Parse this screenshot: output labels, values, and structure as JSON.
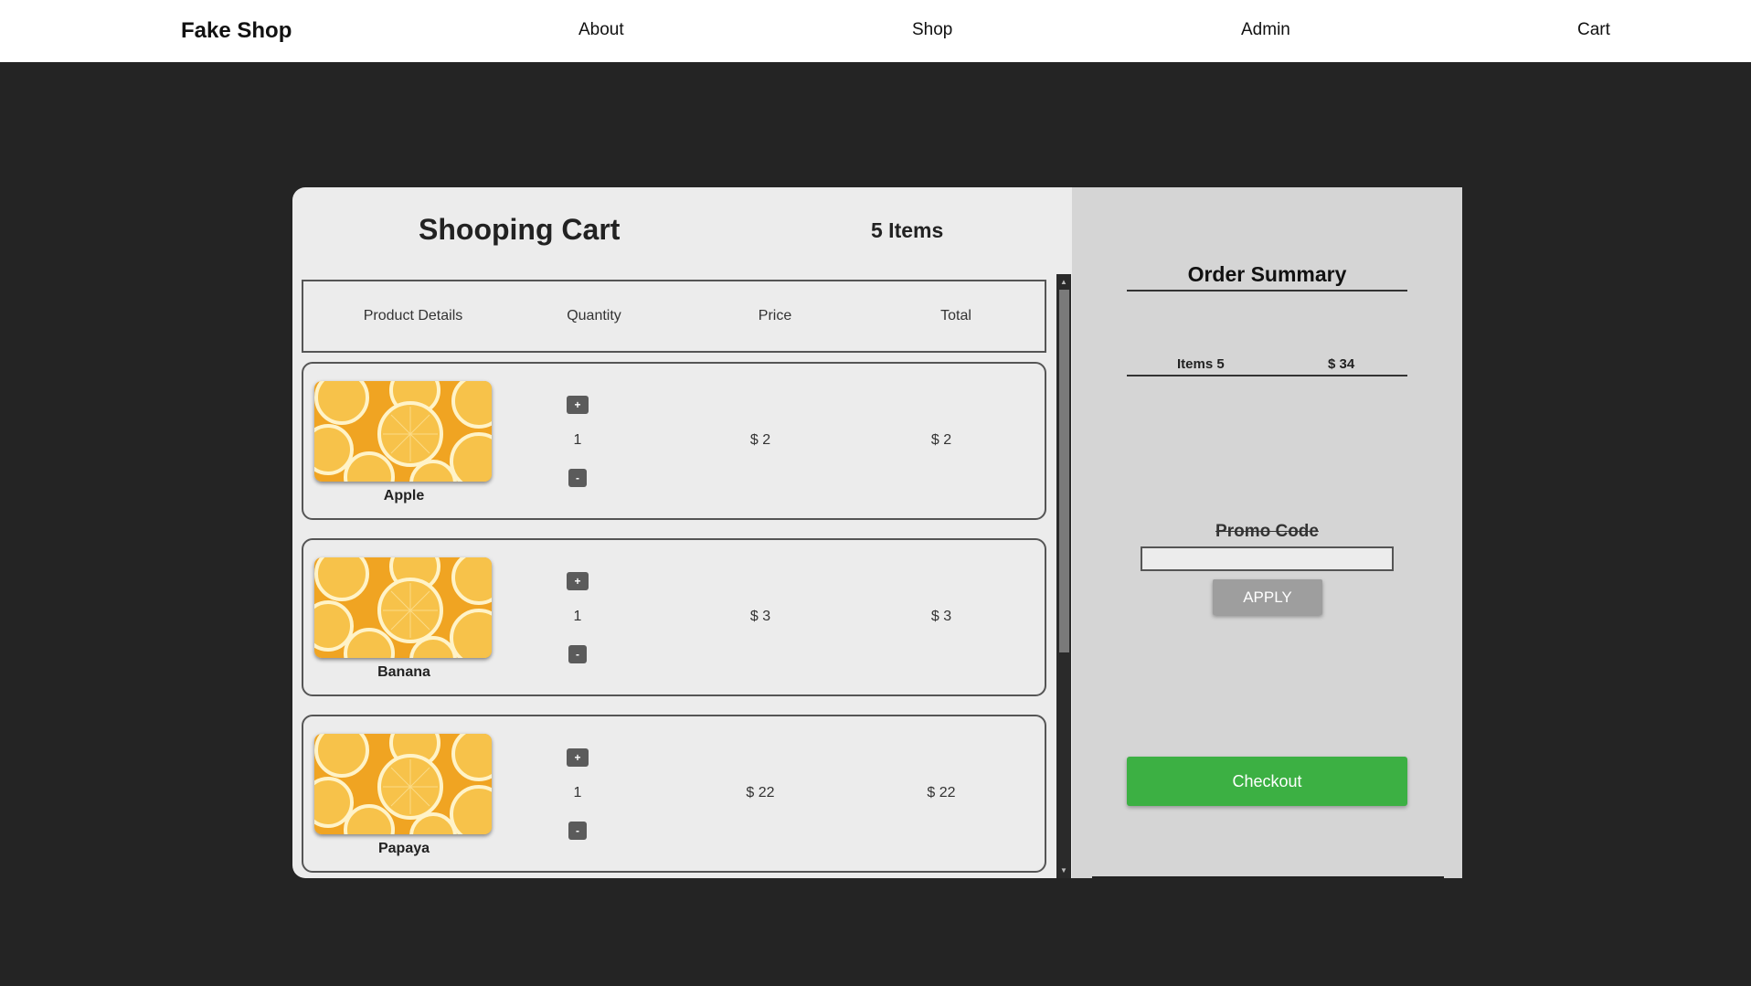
{
  "nav": {
    "brand": "Fake Shop",
    "links": [
      "About",
      "Shop",
      "Admin",
      "Cart"
    ]
  },
  "cart": {
    "title": "Shooping Cart",
    "item_count": "5 Items",
    "columns": [
      "Product Details",
      "Quantity",
      "Price",
      "Total"
    ],
    "items": [
      {
        "name": "Apple",
        "quantity": "1",
        "price": "$ 2",
        "total": "$ 2"
      },
      {
        "name": "Banana",
        "quantity": "1",
        "price": "$ 3",
        "total": "$ 3"
      },
      {
        "name": "Papaya",
        "quantity": "1",
        "price": "$ 22",
        "total": "$ 22"
      }
    ],
    "plus_label": "+",
    "minus_label": "-"
  },
  "summary": {
    "title": "Order Summary",
    "items_label": "Items 5",
    "total": "$ 34",
    "promo_label": "Promo Code",
    "promo_value": "",
    "apply_label": "APPLY",
    "checkout_label": "Checkout"
  },
  "colors": {
    "background": "#242424",
    "nav": "#ffffff",
    "cart_panel": "#ececec",
    "summary_panel": "#d5d5d5",
    "checkout": "#3cb043",
    "apply": "#9e9e9e"
  },
  "icons": {
    "product_image": "orange-slices-image",
    "scroll_up": "scroll-up-arrow-icon",
    "scroll_down": "scroll-down-arrow-icon"
  }
}
